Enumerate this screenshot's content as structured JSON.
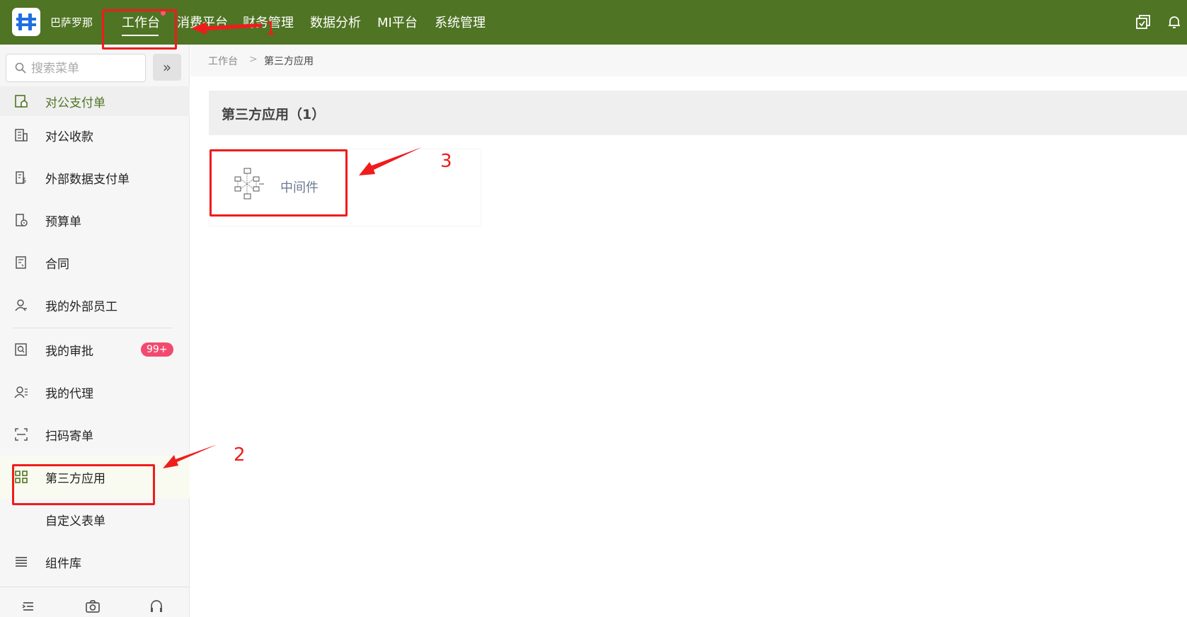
{
  "header": {
    "brand": "巴萨罗那",
    "nav": [
      {
        "label": "工作台",
        "active": true
      },
      {
        "label": "消费平台"
      },
      {
        "label": "财务管理"
      },
      {
        "label": "数据分析"
      },
      {
        "label": "MI平台"
      },
      {
        "label": "系统管理"
      }
    ],
    "icons": [
      "window-switch-icon",
      "bell-icon"
    ]
  },
  "sidebar": {
    "search_placeholder": "搜索菜单",
    "items": [
      {
        "label": "对公支付单",
        "icon": "public-payment-icon"
      },
      {
        "label": "对公收款",
        "icon": "building-receipt-icon"
      },
      {
        "label": "外部数据支付单",
        "icon": "dollar-doc-icon"
      },
      {
        "label": "预算单",
        "icon": "budget-doc-icon"
      },
      {
        "label": "合同",
        "icon": "contract-icon"
      },
      {
        "label": "我的外部员工",
        "icon": "user-icon"
      },
      {
        "label": "我的审批",
        "icon": "approval-icon",
        "badge": "99+"
      },
      {
        "label": "我的代理",
        "icon": "proxy-user-icon"
      },
      {
        "label": "扫码寄单",
        "icon": "scan-icon"
      },
      {
        "label": "第三方应用",
        "icon": "grid-icon",
        "active": true
      },
      {
        "label": "自定义表单",
        "icon": ""
      },
      {
        "label": "组件库",
        "icon": "list-icon"
      }
    ],
    "bottom_icons": [
      "indent-icon",
      "camera-icon",
      "headset-icon"
    ]
  },
  "breadcrumb": {
    "home": "工作台",
    "sep": ">",
    "current": "第三方应用"
  },
  "section": {
    "title": "第三方应用（1）"
  },
  "apps": [
    {
      "label": "中间件",
      "icon": "middleware-diagram-icon"
    }
  ],
  "annotations": [
    {
      "number": "1"
    },
    {
      "number": "2"
    },
    {
      "number": "3"
    }
  ],
  "colors": {
    "header_bg": "#4f7423",
    "badge": "#f24a6f",
    "annotation": "#f01c1c",
    "sidebar_bg": "#f6f6f6"
  }
}
